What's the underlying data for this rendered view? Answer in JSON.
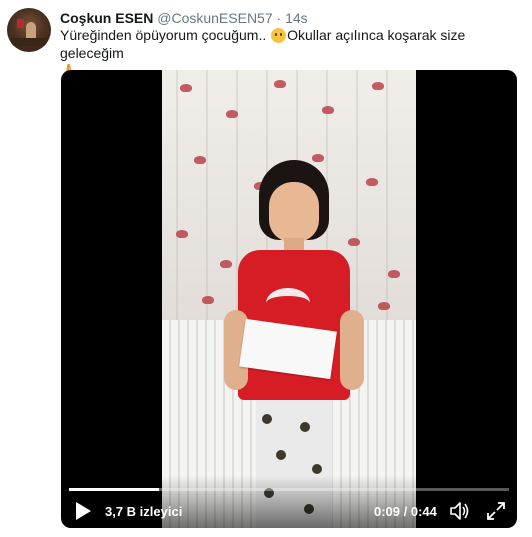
{
  "tweet": {
    "author_name": "Coşkun ESEN",
    "author_handle": "@CoskunESEN57",
    "separator": "·",
    "time": "14s",
    "text_part1": "Yüreğinden öpüyorum çocuğum..",
    "text_part2": "Okullar açılınca koşarak size geleceğim",
    "emoji_1": "face-emoji",
    "emoji_2": "folded-hands-emoji"
  },
  "video": {
    "views": "3,7 B izleyici",
    "time_display": "0:09 / 0:44",
    "progress_fraction": 0.2045,
    "icons": [
      "play-icon",
      "volume-icon",
      "fullscreen-icon"
    ]
  },
  "colors": {
    "text": "#14171a",
    "secondary_text": "#657786",
    "video_bg": "#000000",
    "shirt_red": "#d61c25"
  }
}
